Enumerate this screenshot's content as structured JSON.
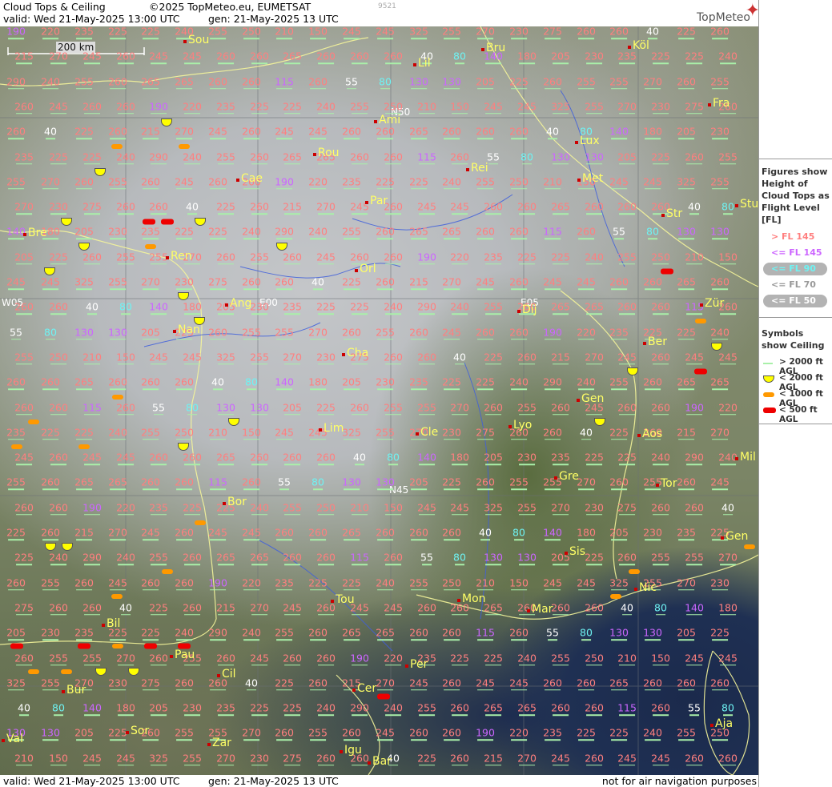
{
  "header": {
    "title": "Cloud Tops & Ceiling",
    "copyright": "©2025 TopMeteo.eu, EUMETSAT",
    "valid": "valid:  Wed  21-May-2025  13:00 UTC",
    "generated": "gen: 21-May-2025 13 UTC",
    "id": "9521",
    "brand": "TopMeteo"
  },
  "scale_label": "200 km",
  "grid_labels": {
    "w05": "W05",
    "e00": "E00",
    "e05": "E05",
    "n50": "N50",
    "n45": "N45"
  },
  "legend": {
    "title": "Figures show Height of Cloud Tops as Flight Level  [FL]",
    "fl_items": [
      {
        "label": "> FL 145",
        "color": "#ff7f7f"
      },
      {
        "label": "<= FL 145",
        "color": "#cc66ff"
      },
      {
        "label": "<= FL 90",
        "color": "#6ef3f3"
      },
      {
        "label": "<= FL 70",
        "color": "#ffffff"
      },
      {
        "label": "<= FL 50",
        "color": "#ffffff"
      }
    ],
    "symbols_title": "Symbols show Ceiling",
    "symbol_items": [
      {
        "label": "> 2000 ft AGL",
        "type": "line"
      },
      {
        "label": "< 2000 ft AGL",
        "type": "yellow"
      },
      {
        "label": "< 1000 ft AGL",
        "type": "orange"
      },
      {
        "label": "< 500 ft AGL",
        "type": "red"
      }
    ]
  },
  "footer": {
    "valid": "valid:  Wed  21-May-2025  13:00 UTC",
    "generated": "gen: 21-May-2025 13 UTC",
    "disclaimer": "not for air navigation purposes"
  },
  "colors": {
    "high": "#ff7f7f",
    "mid": "#cc66ff",
    "low": "#6ef3f3",
    "vlow": "#ffffff",
    "ceiling_line": "#a9f0a9"
  },
  "cities": [
    "Sou",
    "Lil",
    "Bru",
    "Köl",
    "Ami",
    "Fra",
    "Lux",
    "Rou",
    "Rei",
    "Cae",
    "Met",
    "Par",
    "Str",
    "Stu",
    "Bre",
    "Ren",
    "Orl",
    "Ang",
    "Nan",
    "Dij",
    "Zür",
    "Ber",
    "Cha",
    "Gen",
    "Lim",
    "Cle",
    "Lyo",
    "Aos",
    "Mil",
    "Gre",
    "Tor",
    "Bor",
    "Gen",
    "Sis",
    "Nic",
    "Tou",
    "Mon",
    "Mar",
    "Bil",
    "Pau",
    "Per",
    "Cil",
    "Bur",
    "Cer",
    "Sor",
    "Aja",
    "Val",
    "Zar",
    "Igu",
    "Bar"
  ],
  "fl_values": [
    {
      "v": "190",
      "c": "m"
    },
    {
      "v": "220",
      "c": "h"
    },
    {
      "v": "235",
      "c": "h"
    },
    {
      "v": "225",
      "c": "h"
    },
    {
      "v": "225",
      "c": "h"
    },
    {
      "v": "240",
      "c": "h"
    },
    {
      "v": "255",
      "c": "h"
    },
    {
      "v": "250",
      "c": "h"
    },
    {
      "v": "210",
      "c": "h"
    },
    {
      "v": "150",
      "c": "h"
    },
    {
      "v": "245",
      "c": "h"
    },
    {
      "v": "245",
      "c": "h"
    },
    {
      "v": "325",
      "c": "h"
    },
    {
      "v": "255",
      "c": "h"
    },
    {
      "v": "270",
      "c": "h"
    },
    {
      "v": "230",
      "c": "h"
    },
    {
      "v": "275",
      "c": "h"
    },
    {
      "v": "260",
      "c": "h"
    },
    {
      "v": "260",
      "c": "h"
    },
    {
      "v": "40",
      "c": "w"
    },
    {
      "v": "225",
      "c": "h"
    },
    {
      "v": "260",
      "c": "h"
    },
    {
      "v": "215",
      "c": "h"
    },
    {
      "v": "270",
      "c": "h"
    },
    {
      "v": "245",
      "c": "h"
    },
    {
      "v": "260",
      "c": "h"
    },
    {
      "v": "245",
      "c": "h"
    },
    {
      "v": "245",
      "c": "h"
    },
    {
      "v": "260",
      "c": "h"
    },
    {
      "v": "260",
      "c": "h"
    },
    {
      "v": "265",
      "c": "h"
    },
    {
      "v": "260",
      "c": "h"
    },
    {
      "v": "260",
      "c": "h"
    },
    {
      "v": "260",
      "c": "h"
    },
    {
      "v": "40",
      "c": "w"
    },
    {
      "v": "80",
      "c": "l"
    },
    {
      "v": "140",
      "c": "m"
    },
    {
      "v": "180",
      "c": "h"
    },
    {
      "v": "205",
      "c": "h"
    },
    {
      "v": "230",
      "c": "h"
    },
    {
      "v": "235",
      "c": "h"
    },
    {
      "v": "225",
      "c": "h"
    },
    {
      "v": "225",
      "c": "h"
    },
    {
      "v": "240",
      "c": "h"
    },
    {
      "v": "290",
      "c": "h"
    },
    {
      "v": "240",
      "c": "h"
    },
    {
      "v": "255",
      "c": "h"
    },
    {
      "v": "260",
      "c": "h"
    },
    {
      "v": "265",
      "c": "h"
    },
    {
      "v": "265",
      "c": "h"
    },
    {
      "v": "260",
      "c": "h"
    },
    {
      "v": "260",
      "c": "h"
    },
    {
      "v": "115",
      "c": "m"
    },
    {
      "v": "260",
      "c": "h"
    },
    {
      "v": "55",
      "c": "w"
    },
    {
      "v": "80",
      "c": "l"
    },
    {
      "v": "130",
      "c": "m"
    },
    {
      "v": "130",
      "c": "m"
    },
    {
      "v": "205",
      "c": "h"
    },
    {
      "v": "225",
      "c": "h"
    },
    {
      "v": "260",
      "c": "h"
    },
    {
      "v": "255",
      "c": "h"
    },
    {
      "v": "255",
      "c": "h"
    },
    {
      "v": "270",
      "c": "h"
    },
    {
      "v": "260",
      "c": "h"
    },
    {
      "v": "255",
      "c": "h"
    },
    {
      "v": "260",
      "c": "h"
    },
    {
      "v": "245",
      "c": "h"
    },
    {
      "v": "260",
      "c": "h"
    },
    {
      "v": "260",
      "c": "h"
    }
  ]
}
